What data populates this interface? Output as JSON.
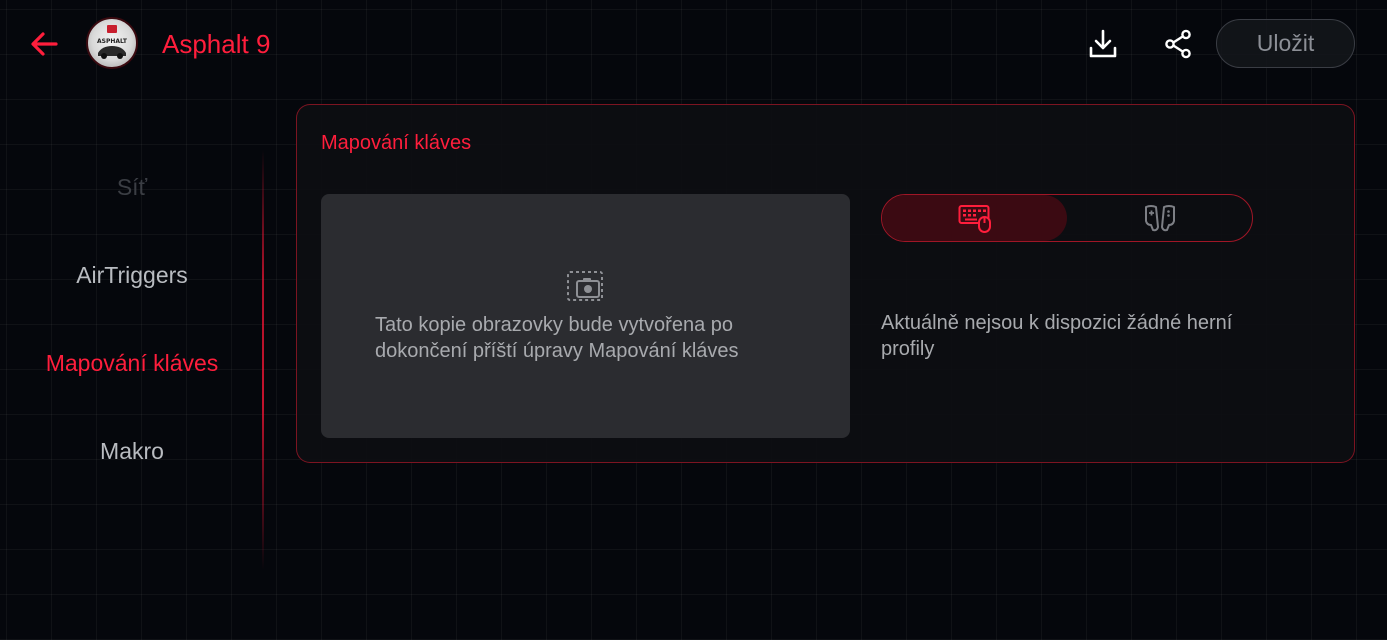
{
  "header": {
    "app_title": "Asphalt 9",
    "avatar_logo_text": "ASPHALT",
    "save_label": "Uložit",
    "back_icon": "arrow-left-icon",
    "download_icon": "download-icon",
    "share_icon": "share-icon"
  },
  "sidebar": {
    "items": [
      {
        "label": "Síť",
        "state": "disabled"
      },
      {
        "label": "AirTriggers",
        "state": "normal"
      },
      {
        "label": "Mapování kláves",
        "state": "active"
      },
      {
        "label": "Makro",
        "state": "normal"
      }
    ]
  },
  "main": {
    "section_title": "Mapování kláves",
    "preview": {
      "icon": "screenshot-icon",
      "text": "Tato kopie obrazovky bude vytvořena po dokončení příští úpravy Mapování kláves"
    },
    "toggle": {
      "options": [
        {
          "icon": "keyboard-mouse-icon",
          "selected": true
        },
        {
          "icon": "gamepad-icon",
          "selected": false
        }
      ]
    },
    "empty_text": "Aktuálně nejsou k dispozici žádné herní profily"
  },
  "colors": {
    "accent": "#ff1e3c",
    "background": "#05070c",
    "card_border": "#c8192d",
    "preview_bg": "#2b2c30",
    "toggle_selected_bg": "#3b0a12"
  }
}
